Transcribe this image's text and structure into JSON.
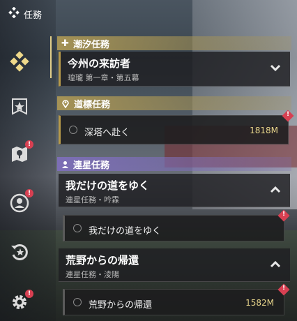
{
  "header": {
    "title": "任務"
  },
  "nav": [
    {
      "name": "nav-main-quest",
      "icon": "diamond-cluster-icon",
      "active": true,
      "alert": false
    },
    {
      "name": "nav-banner",
      "icon": "banner-shield-icon",
      "active": false,
      "alert": false
    },
    {
      "name": "nav-map",
      "icon": "map-pin-icon",
      "active": false,
      "alert": true
    },
    {
      "name": "nav-companion",
      "icon": "person-circle-icon",
      "active": false,
      "alert": true
    },
    {
      "name": "nav-daily",
      "icon": "refresh-star-icon",
      "active": false,
      "alert": false
    },
    {
      "name": "nav-settings",
      "icon": "gear-icon",
      "active": false,
      "alert": true
    }
  ],
  "alert_mark": "!",
  "sections": {
    "tide": {
      "label": "潮汐任務",
      "icon": "plus-icon"
    },
    "waypoint": {
      "label": "道標任務",
      "icon": "location-pin-icon"
    },
    "companion": {
      "label": "連星任務",
      "icon": "person-icon"
    }
  },
  "tide_quest": {
    "title": "今州の来訪者",
    "subtitle": "瑝瓏 第一章・第五幕"
  },
  "waypoint_quest": {
    "label": "深塔へ赴く",
    "distance": "1818M"
  },
  "companion_quest_1": {
    "title": "我だけの道をゆく",
    "subtitle": "連星任務・吟霖",
    "step": "我だけの道をゆく"
  },
  "companion_quest_2": {
    "title": "荒野からの帰還",
    "subtitle": "連星任務・淩陽",
    "step": "荒野からの帰還",
    "distance": "1582M"
  },
  "colors": {
    "accent_gold": "#e2cf8a",
    "accent_purple": "#7d6eb9",
    "alert_red": "#d84052"
  }
}
